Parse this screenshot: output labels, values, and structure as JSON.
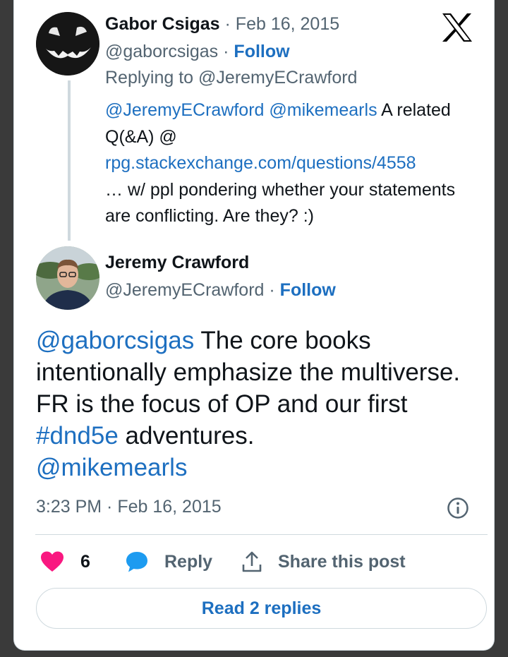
{
  "brand": {
    "logo_icon": "x-logo-icon"
  },
  "reply_tweet": {
    "author_name": "Gabor Csigas",
    "separator": "·",
    "date": "Feb 16, 2015",
    "handle": "@gaborcsigas",
    "follow_label": "Follow",
    "replying_to_prefix": "Replying to",
    "replying_to_handle": "@JeremyECrawford",
    "body": {
      "mention1": "@JeremyECrawford",
      "mention2": "@mikemearls",
      "text1": " A related Q(&A) @",
      "url": "rpg.stackexchange.com/questions/4558",
      "text2": "… w/ ppl pondering whether your statements are conflicting. Are they? :)"
    }
  },
  "main_tweet": {
    "author_name": "Jeremy Crawford",
    "handle": "@JeremyECrawford",
    "follow_label": "Follow",
    "body": {
      "mention1": "@gaborcsigas",
      "text1": " The core books intentionally emphasize the multiverse. FR is the focus of OP and our first ",
      "hashtag": "#dnd5e",
      "text2": " adventures.",
      "mention2": "@mikemearls"
    },
    "timestamp": "3:23 PM · Feb 16, 2015",
    "info_icon": "info-icon"
  },
  "actions": {
    "like_count": "6",
    "reply_label": "Reply",
    "share_label": "Share this post"
  },
  "read_replies_label": "Read 2 replies",
  "colors": {
    "link": "#1d6fc0",
    "like": "#f91880",
    "reply_icon": "#1d9bf0",
    "muted": "#536471"
  }
}
